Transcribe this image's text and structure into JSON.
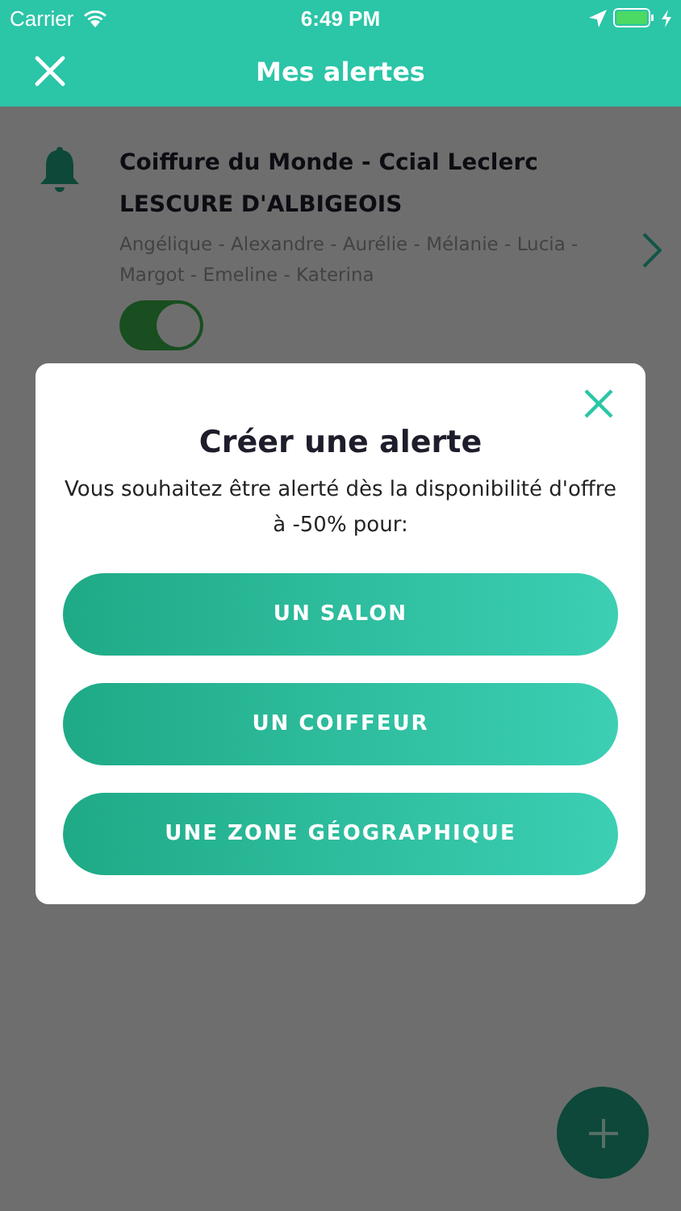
{
  "status_bar": {
    "carrier": "Carrier",
    "time": "6:49 PM"
  },
  "nav": {
    "title": "Mes alertes"
  },
  "alerts": [
    {
      "title": "Coiffure du Monde - Ccial Leclerc",
      "subtitle": "LESCURE D'ALBIGEOIS",
      "staff": "Angélique - Alexandre - Aurélie - Mélanie - Lucia - Margot - Emeline - Katerina",
      "on": true
    }
  ],
  "dialog": {
    "title": "Créer une alerte",
    "message": "Vous souhaitez être alerté dès la disponibilité d'offre à -50% pour:",
    "options": [
      "UN SALON",
      "UN COIFFEUR",
      "UNE ZONE GÉOGRAPHIQUE"
    ]
  }
}
